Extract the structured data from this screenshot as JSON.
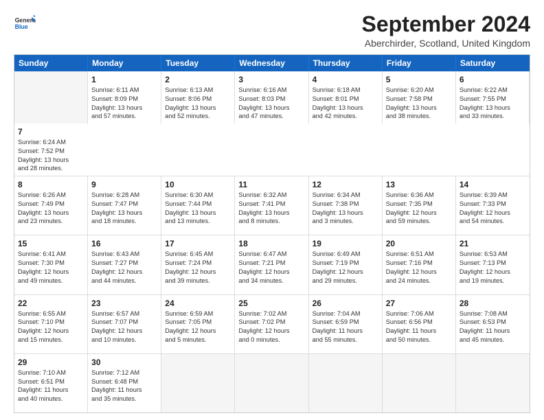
{
  "logo": {
    "general": "General",
    "blue": "Blue"
  },
  "title": "September 2024",
  "location": "Aberchirder, Scotland, United Kingdom",
  "headers": [
    "Sunday",
    "Monday",
    "Tuesday",
    "Wednesday",
    "Thursday",
    "Friday",
    "Saturday"
  ],
  "rows": [
    [
      {
        "day": "",
        "empty": true
      },
      {
        "day": "1",
        "line1": "Sunrise: 6:11 AM",
        "line2": "Sunset: 8:09 PM",
        "line3": "Daylight: 13 hours",
        "line4": "and 57 minutes."
      },
      {
        "day": "2",
        "line1": "Sunrise: 6:13 AM",
        "line2": "Sunset: 8:06 PM",
        "line3": "Daylight: 13 hours",
        "line4": "and 52 minutes."
      },
      {
        "day": "3",
        "line1": "Sunrise: 6:16 AM",
        "line2": "Sunset: 8:03 PM",
        "line3": "Daylight: 13 hours",
        "line4": "and 47 minutes."
      },
      {
        "day": "4",
        "line1": "Sunrise: 6:18 AM",
        "line2": "Sunset: 8:01 PM",
        "line3": "Daylight: 13 hours",
        "line4": "and 42 minutes."
      },
      {
        "day": "5",
        "line1": "Sunrise: 6:20 AM",
        "line2": "Sunset: 7:58 PM",
        "line3": "Daylight: 13 hours",
        "line4": "and 38 minutes."
      },
      {
        "day": "6",
        "line1": "Sunrise: 6:22 AM",
        "line2": "Sunset: 7:55 PM",
        "line3": "Daylight: 13 hours",
        "line4": "and 33 minutes."
      },
      {
        "day": "7",
        "line1": "Sunrise: 6:24 AM",
        "line2": "Sunset: 7:52 PM",
        "line3": "Daylight: 13 hours",
        "line4": "and 28 minutes."
      }
    ],
    [
      {
        "day": "8",
        "line1": "Sunrise: 6:26 AM",
        "line2": "Sunset: 7:49 PM",
        "line3": "Daylight: 13 hours",
        "line4": "and 23 minutes."
      },
      {
        "day": "9",
        "line1": "Sunrise: 6:28 AM",
        "line2": "Sunset: 7:47 PM",
        "line3": "Daylight: 13 hours",
        "line4": "and 18 minutes."
      },
      {
        "day": "10",
        "line1": "Sunrise: 6:30 AM",
        "line2": "Sunset: 7:44 PM",
        "line3": "Daylight: 13 hours",
        "line4": "and 13 minutes."
      },
      {
        "day": "11",
        "line1": "Sunrise: 6:32 AM",
        "line2": "Sunset: 7:41 PM",
        "line3": "Daylight: 13 hours",
        "line4": "and 8 minutes."
      },
      {
        "day": "12",
        "line1": "Sunrise: 6:34 AM",
        "line2": "Sunset: 7:38 PM",
        "line3": "Daylight: 13 hours",
        "line4": "and 3 minutes."
      },
      {
        "day": "13",
        "line1": "Sunrise: 6:36 AM",
        "line2": "Sunset: 7:35 PM",
        "line3": "Daylight: 12 hours",
        "line4": "and 59 minutes."
      },
      {
        "day": "14",
        "line1": "Sunrise: 6:39 AM",
        "line2": "Sunset: 7:33 PM",
        "line3": "Daylight: 12 hours",
        "line4": "and 54 minutes."
      }
    ],
    [
      {
        "day": "15",
        "line1": "Sunrise: 6:41 AM",
        "line2": "Sunset: 7:30 PM",
        "line3": "Daylight: 12 hours",
        "line4": "and 49 minutes."
      },
      {
        "day": "16",
        "line1": "Sunrise: 6:43 AM",
        "line2": "Sunset: 7:27 PM",
        "line3": "Daylight: 12 hours",
        "line4": "and 44 minutes."
      },
      {
        "day": "17",
        "line1": "Sunrise: 6:45 AM",
        "line2": "Sunset: 7:24 PM",
        "line3": "Daylight: 12 hours",
        "line4": "and 39 minutes."
      },
      {
        "day": "18",
        "line1": "Sunrise: 6:47 AM",
        "line2": "Sunset: 7:21 PM",
        "line3": "Daylight: 12 hours",
        "line4": "and 34 minutes."
      },
      {
        "day": "19",
        "line1": "Sunrise: 6:49 AM",
        "line2": "Sunset: 7:19 PM",
        "line3": "Daylight: 12 hours",
        "line4": "and 29 minutes."
      },
      {
        "day": "20",
        "line1": "Sunrise: 6:51 AM",
        "line2": "Sunset: 7:16 PM",
        "line3": "Daylight: 12 hours",
        "line4": "and 24 minutes."
      },
      {
        "day": "21",
        "line1": "Sunrise: 6:53 AM",
        "line2": "Sunset: 7:13 PM",
        "line3": "Daylight: 12 hours",
        "line4": "and 19 minutes."
      }
    ],
    [
      {
        "day": "22",
        "line1": "Sunrise: 6:55 AM",
        "line2": "Sunset: 7:10 PM",
        "line3": "Daylight: 12 hours",
        "line4": "and 15 minutes."
      },
      {
        "day": "23",
        "line1": "Sunrise: 6:57 AM",
        "line2": "Sunset: 7:07 PM",
        "line3": "Daylight: 12 hours",
        "line4": "and 10 minutes."
      },
      {
        "day": "24",
        "line1": "Sunrise: 6:59 AM",
        "line2": "Sunset: 7:05 PM",
        "line3": "Daylight: 12 hours",
        "line4": "and 5 minutes."
      },
      {
        "day": "25",
        "line1": "Sunrise: 7:02 AM",
        "line2": "Sunset: 7:02 PM",
        "line3": "Daylight: 12 hours",
        "line4": "and 0 minutes."
      },
      {
        "day": "26",
        "line1": "Sunrise: 7:04 AM",
        "line2": "Sunset: 6:59 PM",
        "line3": "Daylight: 11 hours",
        "line4": "and 55 minutes."
      },
      {
        "day": "27",
        "line1": "Sunrise: 7:06 AM",
        "line2": "Sunset: 6:56 PM",
        "line3": "Daylight: 11 hours",
        "line4": "and 50 minutes."
      },
      {
        "day": "28",
        "line1": "Sunrise: 7:08 AM",
        "line2": "Sunset: 6:53 PM",
        "line3": "Daylight: 11 hours",
        "line4": "and 45 minutes."
      }
    ],
    [
      {
        "day": "29",
        "line1": "Sunrise: 7:10 AM",
        "line2": "Sunset: 6:51 PM",
        "line3": "Daylight: 11 hours",
        "line4": "and 40 minutes."
      },
      {
        "day": "30",
        "line1": "Sunrise: 7:12 AM",
        "line2": "Sunset: 6:48 PM",
        "line3": "Daylight: 11 hours",
        "line4": "and 35 minutes."
      },
      {
        "day": "",
        "empty": true
      },
      {
        "day": "",
        "empty": true
      },
      {
        "day": "",
        "empty": true
      },
      {
        "day": "",
        "empty": true
      },
      {
        "day": "",
        "empty": true
      }
    ]
  ]
}
